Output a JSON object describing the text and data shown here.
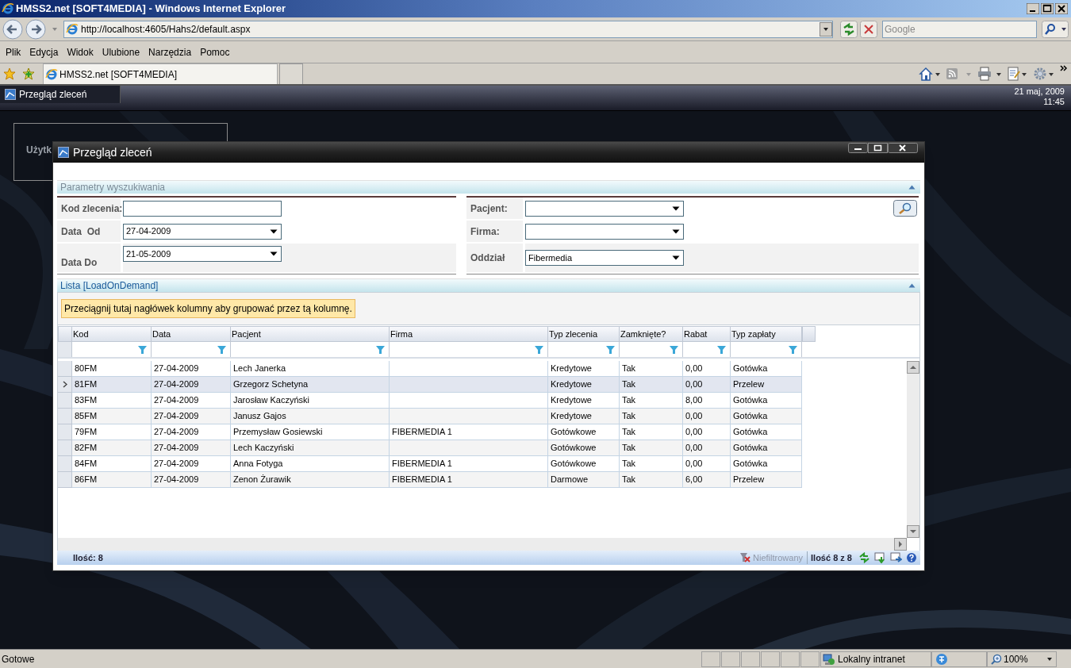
{
  "browser": {
    "title": "HMSS2.net [SOFT4MEDIA] - Windows Internet Explorer",
    "address": "http://localhost:4605/Hahs2/default.aspx",
    "search_placeholder": "Google",
    "menu": [
      "Plik",
      "Edycja",
      "Widok",
      "Ulubione",
      "Narzędzia",
      "Pomoc"
    ],
    "tab_label": "HMSS2.net [SOFT4MEDIA]"
  },
  "app_bar": {
    "taskbar_item": "Przegląd zleceń",
    "date": "21 maj, 2009",
    "time": "11:45"
  },
  "background_panel": {
    "text": "Użytk"
  },
  "dialog": {
    "title": "Przegląd zleceń",
    "search_section_title": "Parametry wyszukiwania",
    "left_fields": [
      {
        "label": "Kod zlecenia:",
        "kind": "text"
      },
      {
        "label": "Data  Od",
        "kind": "dropdown",
        "value": "27-04-2009"
      },
      {
        "label": "Data Do",
        "kind": "dropdown",
        "value": "21-05-2009"
      }
    ],
    "right_fields": [
      {
        "label": "Pacjent:",
        "kind": "dropdown"
      },
      {
        "label": "Firma:",
        "kind": "dropdown"
      },
      {
        "label": "Oddział",
        "kind": "dropdown",
        "value": "Fibermedia"
      }
    ],
    "list_title": "Lista [LoadOnDemand]",
    "group_hint": "Przeciągnij tutaj nagłówek kolumny aby grupować przez tą kolumnę.",
    "columns": [
      "Kod",
      "Data",
      "Pacjent",
      "Firma",
      "Typ zlecenia",
      "Zamknięte?",
      "Rabat",
      "Typ zapłaty"
    ],
    "rows": [
      {
        "selected": false,
        "cells": [
          "80FM",
          "27-04-2009",
          "Lech Janerka",
          "",
          "Kredytowe",
          "Tak",
          "0,00",
          "Gotówka"
        ]
      },
      {
        "selected": true,
        "cells": [
          "81FM",
          "27-04-2009",
          "Grzegorz Schetyna",
          "",
          "Kredytowe",
          "Tak",
          "0,00",
          "Przelew"
        ]
      },
      {
        "selected": false,
        "cells": [
          "83FM",
          "27-04-2009",
          "Jarosław Kaczyński",
          "",
          "Kredytowe",
          "Tak",
          "8,00",
          "Gotówka"
        ]
      },
      {
        "selected": false,
        "cells": [
          "85FM",
          "27-04-2009",
          "Janusz Gajos",
          "",
          "Kredytowe",
          "Tak",
          "0,00",
          "Gotówka"
        ]
      },
      {
        "selected": false,
        "cells": [
          "79FM",
          "27-04-2009",
          "Przemysław Gosiewski",
          "FIBERMEDIA 1",
          "Gotówkowe",
          "Tak",
          "0,00",
          "Gotówka"
        ]
      },
      {
        "selected": false,
        "cells": [
          "82FM",
          "27-04-2009",
          "Lech Kaczyński",
          "",
          "Gotówkowe",
          "Tak",
          "0,00",
          "Gotówka"
        ]
      },
      {
        "selected": false,
        "cells": [
          "84FM",
          "27-04-2009",
          "Anna Fotyga",
          "FIBERMEDIA 1",
          "Gotówkowe",
          "Tak",
          "0,00",
          "Gotówka"
        ]
      },
      {
        "selected": false,
        "cells": [
          "86FM",
          "27-04-2009",
          "Zenon Żurawik",
          "FIBERMEDIA 1",
          "Darmowe",
          "Tak",
          "6,00",
          "Przelew"
        ]
      }
    ],
    "footer": {
      "count": "Ilość: 8",
      "filter_status": "Niefiltrowany",
      "paging": "Ilość 8 z 8"
    }
  },
  "status_bar": {
    "text": "Gotowe",
    "zone": "Lokalny intranet",
    "zoom": "100%"
  }
}
